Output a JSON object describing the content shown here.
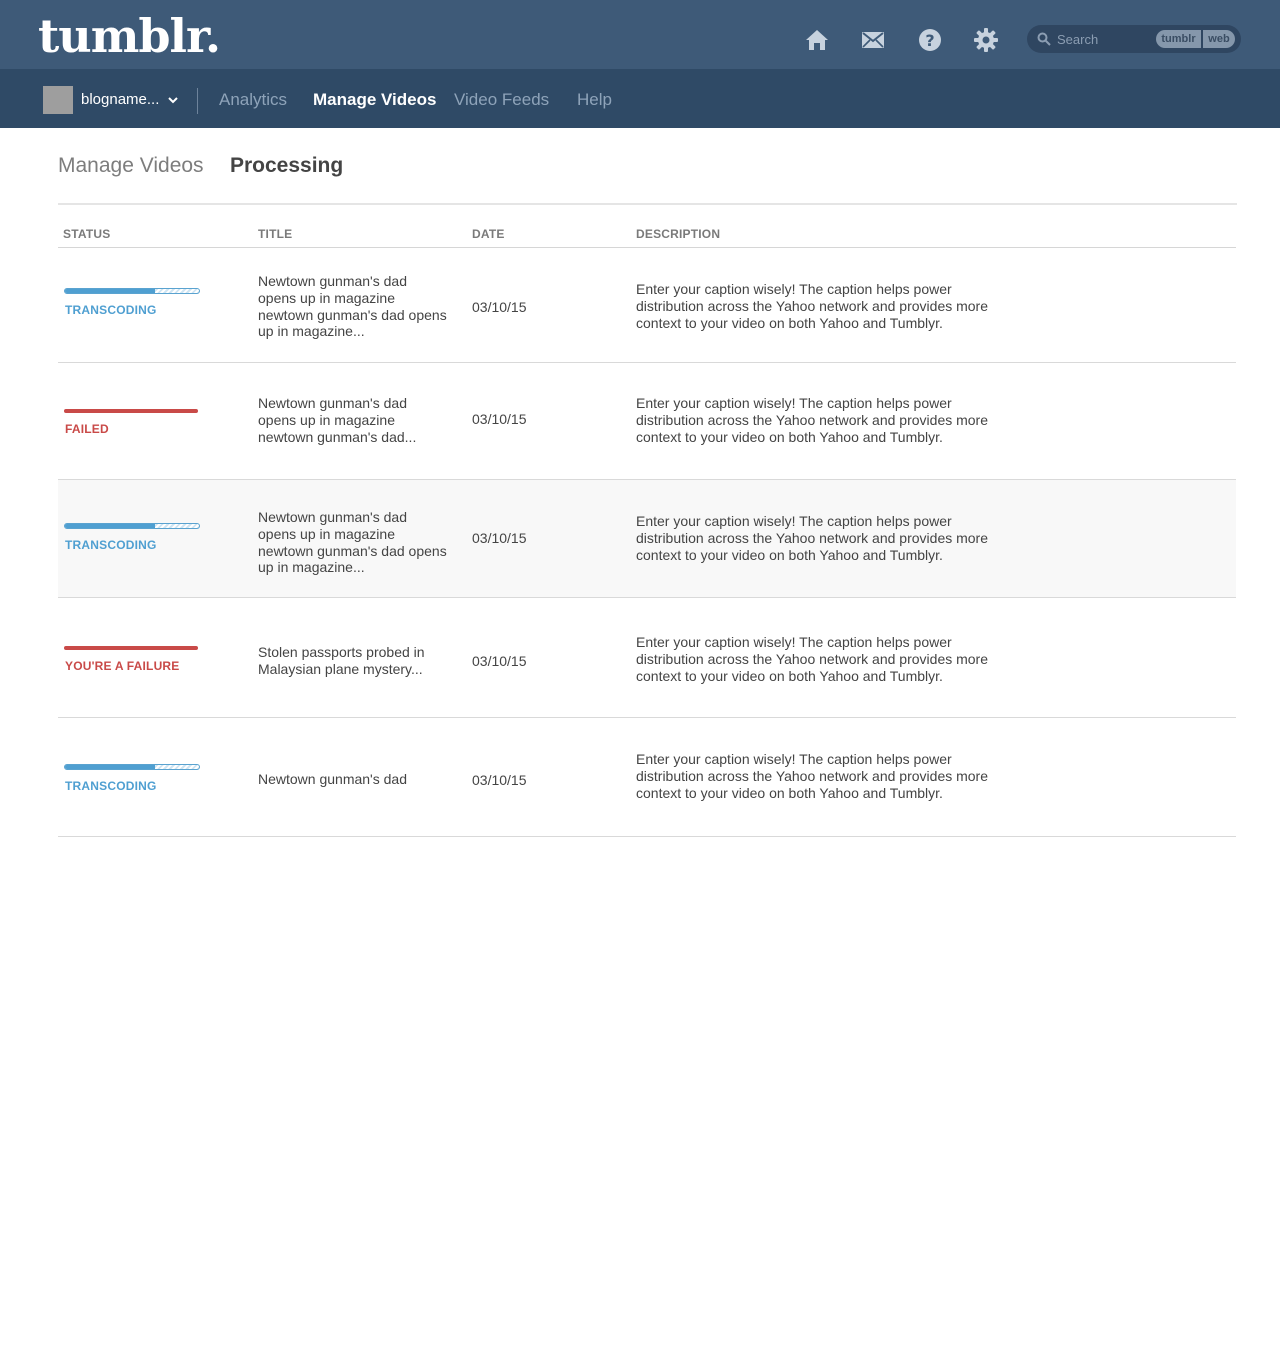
{
  "header": {
    "logo": "tumblr.",
    "icons": [
      "home-icon",
      "mail-icon",
      "help-icon",
      "settings-icon"
    ],
    "search": {
      "placeholder": "Search",
      "scopes": [
        "tumblr",
        "web"
      ]
    }
  },
  "subnav": {
    "blog_name": "blogname...",
    "links": [
      "Analytics",
      "Manage Videos",
      "Video Feeds",
      "Help"
    ],
    "active": "Manage Videos"
  },
  "page_tabs": {
    "manage": "Manage Videos",
    "processing": "Processing",
    "active": "Processing"
  },
  "table": {
    "headers": {
      "status": "STATUS",
      "title": "TITLE",
      "date": "DATE",
      "description": "DESCRIPTION"
    },
    "rows": [
      {
        "status": "TRANSCODING",
        "status_kind": "progress",
        "progress": 0.67,
        "title": "Newtown gunman's dad opens up in magazine newtown gunman's dad opens up in magazine...",
        "date": "03/10/15",
        "description": "Enter your caption wisely! The caption helps power distribution across the Yahoo network and provides more context to your video on both Yahoo and Tumblyr."
      },
      {
        "status": "FAILED",
        "status_kind": "failed",
        "title": "Newtown gunman's dad opens up in magazine newtown gunman's dad...",
        "date": "03/10/15",
        "description": "Enter your caption wisely! The caption helps power distribution across the Yahoo network and provides more context to your video on both Yahoo and Tumblyr."
      },
      {
        "status": "TRANSCODING",
        "status_kind": "progress",
        "progress": 0.67,
        "title": "Newtown gunman's dad opens up in magazine newtown gunman's dad opens up in magazine...",
        "date": "03/10/15",
        "description": "Enter your caption wisely! The caption helps power distribution across the Yahoo network and provides more context to your video on both Yahoo and Tumblyr."
      },
      {
        "status": "YOU'RE A FAILURE",
        "status_kind": "failed",
        "title": "Stolen passports probed in Malaysian plane mystery...",
        "date": "03/10/15",
        "description": "Enter your caption wisely! The caption helps power distribution across the Yahoo network and provides more context to your video on both Yahoo and Tumblyr."
      },
      {
        "status": "TRANSCODING",
        "status_kind": "progress",
        "progress": 0.67,
        "title": "Newtown gunman's dad",
        "date": "03/10/15",
        "description": "Enter your caption wisely! The caption helps power distribution across the Yahoo network and provides more context to your video on both Yahoo and Tumblyr."
      }
    ]
  },
  "colors": {
    "header_bg": "#3e5a78",
    "subnav_bg": "#2f4a66",
    "progress_blue": "#4f9fd1",
    "failed_red": "#c94a48"
  }
}
